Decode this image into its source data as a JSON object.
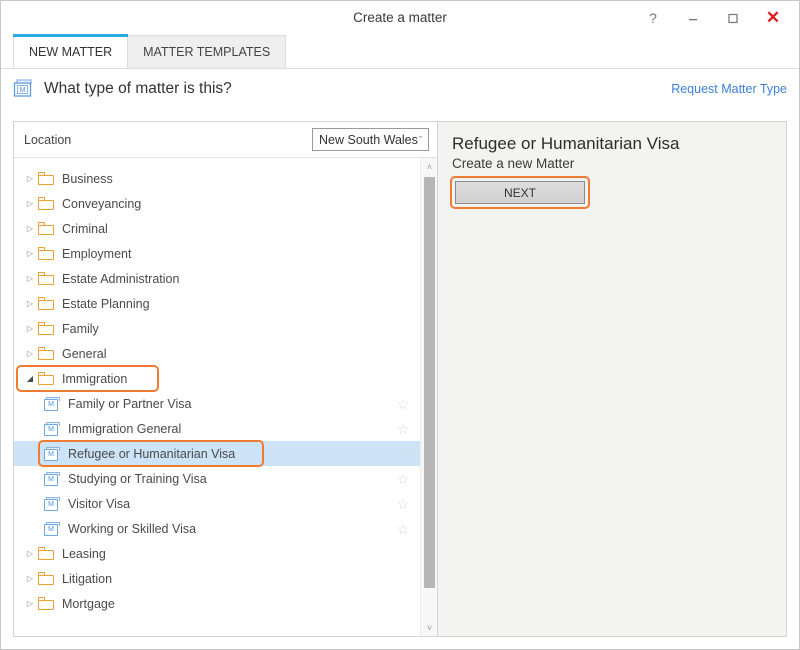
{
  "window": {
    "title": "Create a matter",
    "controls": [
      {
        "name": "help-button",
        "glyph": "?"
      },
      {
        "name": "minimize-button",
        "glyph": "–"
      },
      {
        "name": "maximize-button",
        "glyph": "☐"
      },
      {
        "name": "close-button",
        "glyph": "✕"
      }
    ]
  },
  "tabs": [
    {
      "label": "NEW MATTER",
      "active": true
    },
    {
      "label": "MATTER TEMPLATES",
      "active": false
    }
  ],
  "header": {
    "icon": "matter-type-icon",
    "question": "What type of matter is this?",
    "request_link": "Request Matter Type"
  },
  "location": {
    "label": "Location",
    "selected": "New South Wales",
    "caret": "ˇ"
  },
  "tree": {
    "items": [
      {
        "label": "Business",
        "type": "folder",
        "expanded": false,
        "level": 0,
        "star": false,
        "selected": false,
        "highlight": false
      },
      {
        "label": "Conveyancing",
        "type": "folder",
        "expanded": false,
        "level": 0,
        "star": false,
        "selected": false,
        "highlight": false
      },
      {
        "label": "Criminal",
        "type": "folder",
        "expanded": false,
        "level": 0,
        "star": false,
        "selected": false,
        "highlight": false
      },
      {
        "label": "Employment",
        "type": "folder",
        "expanded": false,
        "level": 0,
        "star": false,
        "selected": false,
        "highlight": false
      },
      {
        "label": "Estate Administration",
        "type": "folder",
        "expanded": false,
        "level": 0,
        "star": false,
        "selected": false,
        "highlight": false
      },
      {
        "label": "Estate Planning",
        "type": "folder",
        "expanded": false,
        "level": 0,
        "star": false,
        "selected": false,
        "highlight": false
      },
      {
        "label": "Family",
        "type": "folder",
        "expanded": false,
        "level": 0,
        "star": false,
        "selected": false,
        "highlight": false
      },
      {
        "label": "General",
        "type": "folder",
        "expanded": false,
        "level": 0,
        "star": false,
        "selected": false,
        "highlight": false
      },
      {
        "label": "Immigration",
        "type": "folder",
        "expanded": true,
        "level": 0,
        "star": false,
        "selected": false,
        "highlight": true
      },
      {
        "label": "Family or Partner Visa",
        "type": "matter",
        "level": 1,
        "star": true,
        "selected": false,
        "highlight": false
      },
      {
        "label": "Immigration General",
        "type": "matter",
        "level": 1,
        "star": true,
        "selected": false,
        "highlight": false
      },
      {
        "label": "Refugee or Humanitarian Visa",
        "type": "matter",
        "level": 1,
        "star": true,
        "selected": true,
        "highlight": true
      },
      {
        "label": "Studying or Training Visa",
        "type": "matter",
        "level": 1,
        "star": true,
        "selected": false,
        "highlight": false
      },
      {
        "label": "Visitor Visa",
        "type": "matter",
        "level": 1,
        "star": true,
        "selected": false,
        "highlight": false
      },
      {
        "label": "Working or Skilled Visa",
        "type": "matter",
        "level": 1,
        "star": true,
        "selected": false,
        "highlight": false
      },
      {
        "label": "Leasing",
        "type": "folder",
        "expanded": false,
        "level": 0,
        "star": false,
        "selected": false,
        "highlight": false
      },
      {
        "label": "Litigation",
        "type": "folder",
        "expanded": false,
        "level": 0,
        "star": false,
        "selected": false,
        "highlight": false
      },
      {
        "label": "Mortgage",
        "type": "folder",
        "expanded": false,
        "level": 0,
        "star": false,
        "selected": false,
        "highlight": false
      }
    ],
    "collapsed_glyph": "▷",
    "expanded_glyph": "◢",
    "star_glyph": "☆",
    "matter_letter": "M"
  },
  "scrollbar": {
    "up_glyph": "˄",
    "down_glyph": "˅"
  },
  "details": {
    "title": "Refugee or Humanitarian Visa",
    "subtitle": "Create a new Matter",
    "next_label": "NEXT"
  },
  "colors": {
    "accent_blue": "#2aaae2",
    "highlight_orange": "#ef7c32",
    "selection_blue": "#cde3f7",
    "folder_orange": "#f0a030",
    "link_blue": "#3c80d8",
    "close_red": "#e01b24",
    "panel_gray": "#f3f3f1"
  }
}
